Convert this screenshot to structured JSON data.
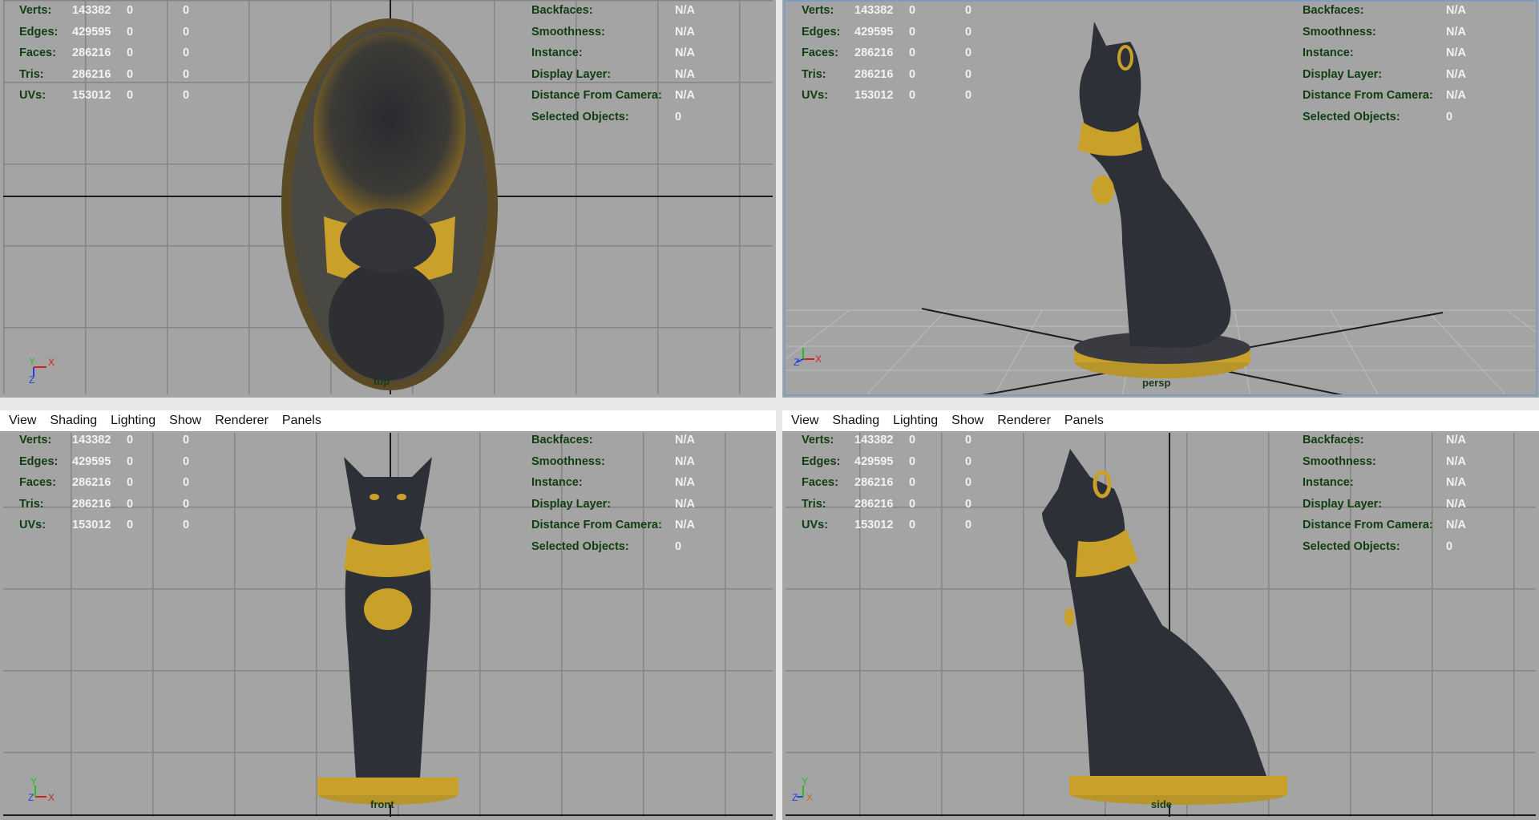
{
  "menu": [
    "View",
    "Shading",
    "Lighting",
    "Show",
    "Renderer",
    "Panels"
  ],
  "hud_left": {
    "rows": [
      {
        "label": "Verts:",
        "v1": "143382",
        "v2": "0",
        "v3": "0"
      },
      {
        "label": "Edges:",
        "v1": "429595",
        "v2": "0",
        "v3": "0"
      },
      {
        "label": "Faces:",
        "v1": "286216",
        "v2": "0",
        "v3": "0"
      },
      {
        "label": "Tris:",
        "v1": "286216",
        "v2": "0",
        "v3": "0"
      },
      {
        "label": "UVs:",
        "v1": "153012",
        "v2": "0",
        "v3": "0"
      }
    ]
  },
  "hud_right": {
    "rows": [
      {
        "label": "Backfaces:",
        "value": "N/A"
      },
      {
        "label": "Smoothness:",
        "value": "N/A"
      },
      {
        "label": "Instance:",
        "value": "N/A"
      },
      {
        "label": "Display Layer:",
        "value": "N/A"
      },
      {
        "label": "Distance From Camera:",
        "value": "N/A"
      },
      {
        "label": "Selected Objects:",
        "value": "0"
      }
    ]
  },
  "viewports": {
    "top": {
      "camera": "top"
    },
    "persp": {
      "camera": "persp"
    },
    "front": {
      "camera": "front"
    },
    "side": {
      "camera": "side"
    }
  },
  "colors": {
    "viewport_bg": "#a4a4a4",
    "grid": "#858585",
    "hud_label": "#103e10",
    "hud_value": "#f2f2f2",
    "statue_body": "#2e3038",
    "statue_gold": "#c9a12a"
  },
  "icons": {
    "axis_gizmo": "xyz-axis-icon"
  }
}
